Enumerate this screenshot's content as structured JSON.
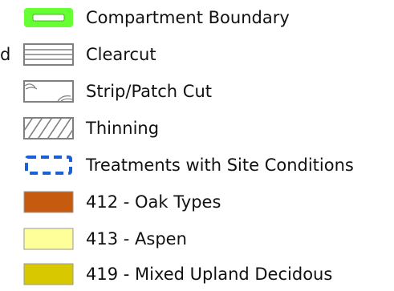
{
  "legend": {
    "clipped_text": "d",
    "items": [
      {
        "id": "compartment-boundary",
        "label": "Compartment Boundary",
        "color": "#66ff33"
      },
      {
        "id": "clearcut",
        "label": "Clearcut",
        "color": "#808080"
      },
      {
        "id": "strip-patch-cut",
        "label": "Strip/Patch Cut",
        "color": "#808080"
      },
      {
        "id": "thinning",
        "label": "Thinning",
        "color": "#808080"
      },
      {
        "id": "treatments-site-conditions",
        "label": "Treatments with Site Conditions",
        "color": "#1a5fd6"
      },
      {
        "id": "oak-types",
        "label": "412 - Oak Types",
        "color": "#c65a0e"
      },
      {
        "id": "aspen",
        "label": "413 - Aspen",
        "color": "#ffff99"
      },
      {
        "id": "mixed-upland-deciduous",
        "label": "419 - Mixed Upland Decidous",
        "color": "#d8c800"
      }
    ],
    "icons": {
      "compartment-boundary": "compartment-boundary-icon",
      "clearcut": "clearcut-hatch-icon",
      "strip-patch-cut": "strip-patch-cut-icon",
      "thinning": "thinning-hatch-icon",
      "treatments-site-conditions": "dashed-boundary-icon",
      "oak-types": "oak-types-swatch",
      "aspen": "aspen-swatch",
      "mixed-upland-deciduous": "mixed-upland-swatch"
    }
  }
}
